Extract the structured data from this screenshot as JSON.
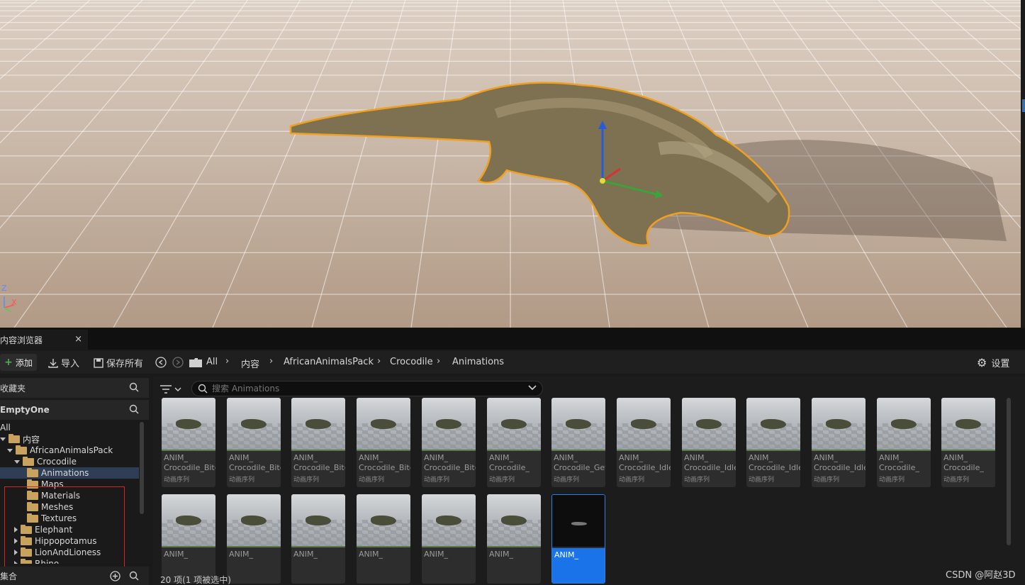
{
  "viewport": {
    "axis": {
      "z": "Z",
      "x": "X"
    }
  },
  "content_browser": {
    "tab_title": "内容浏览器",
    "tab_close": "×",
    "toolbar": {
      "add_label": "添加",
      "import_label": "导入",
      "save_all_label": "保存所有",
      "settings_label": "设置",
      "breadcrumb": [
        "All",
        "内容",
        "AfricanAnimalsPack",
        "Crocodile",
        "Animations"
      ]
    },
    "sidebar": {
      "favorites_label": "收藏夹",
      "project_label": "EmptyOne",
      "collections_label": "集合",
      "tree": [
        {
          "label": "All",
          "depth": 0,
          "expander": "none",
          "folder": false
        },
        {
          "label": "内容",
          "depth": 0,
          "expander": "down",
          "folder": true
        },
        {
          "label": "AfricanAnimalsPack",
          "depth": 1,
          "expander": "down",
          "folder": true
        },
        {
          "label": "Crocodile",
          "depth": 2,
          "expander": "down",
          "folder": true
        },
        {
          "label": "Animations",
          "depth": 3,
          "expander": "none",
          "folder": true,
          "selected": true
        },
        {
          "label": "Maps",
          "depth": 3,
          "expander": "none",
          "folder": true
        },
        {
          "label": "Materials",
          "depth": 3,
          "expander": "none",
          "folder": true
        },
        {
          "label": "Meshes",
          "depth": 3,
          "expander": "none",
          "folder": true
        },
        {
          "label": "Textures",
          "depth": 3,
          "expander": "none",
          "folder": true
        },
        {
          "label": "Elephant",
          "depth": 2,
          "expander": "right",
          "folder": true
        },
        {
          "label": "Hippopotamus",
          "depth": 2,
          "expander": "right",
          "folder": true
        },
        {
          "label": "LionAndLioness",
          "depth": 2,
          "expander": "right",
          "folder": true
        },
        {
          "label": "Rhino",
          "depth": 2,
          "expander": "right",
          "folder": true
        }
      ]
    },
    "search": {
      "placeholder": "搜索 Animations"
    },
    "assets": [
      {
        "line1": "ANIM_",
        "line2": "Crocodile_Bite",
        "type": "动画序列"
      },
      {
        "line1": "ANIM_",
        "line2": "Crocodile_Bite",
        "type": "动画序列"
      },
      {
        "line1": "ANIM_",
        "line2": "Crocodile_Bite",
        "type": "动画序列"
      },
      {
        "line1": "ANIM_",
        "line2": "Crocodile_Bite",
        "type": "动画序列"
      },
      {
        "line1": "ANIM_",
        "line2": "Crocodile_Bite",
        "type": "动画序列"
      },
      {
        "line1": "ANIM_",
        "line2": "Crocodile_",
        "type": "动画序列"
      },
      {
        "line1": "ANIM_",
        "line2": "Crocodile_Get",
        "type": "动画序列"
      },
      {
        "line1": "ANIM_",
        "line2": "Crocodile_Idle",
        "type": "动画序列"
      },
      {
        "line1": "ANIM_",
        "line2": "Crocodile_Idle",
        "type": "动画序列"
      },
      {
        "line1": "ANIM_",
        "line2": "Crocodile_Idle",
        "type": "动画序列"
      },
      {
        "line1": "ANIM_",
        "line2": "Crocodile_Idle",
        "type": "动画序列"
      },
      {
        "line1": "ANIM_",
        "line2": "Crocodile_",
        "type": "动画序列"
      },
      {
        "line1": "ANIM_",
        "line2": "Crocodile_",
        "type": "动画序列"
      },
      {
        "line1": "ANIM_",
        "line2": "",
        "type": ""
      },
      {
        "line1": "ANIM_",
        "line2": "",
        "type": ""
      },
      {
        "line1": "ANIM_",
        "line2": "",
        "type": ""
      },
      {
        "line1": "ANIM_",
        "line2": "",
        "type": ""
      },
      {
        "line1": "ANIM_",
        "line2": "",
        "type": ""
      },
      {
        "line1": "ANIM_",
        "line2": "",
        "type": ""
      },
      {
        "line1": "ANIM_",
        "line2": "",
        "type": "",
        "selected": true
      }
    ],
    "status": "20 项(1 项被选中)"
  },
  "watermark": "CSDN @阿赵3D",
  "colors": {
    "selection_outline": "#f0a020",
    "selected_tile": "#1a73e8",
    "red_box": "#e02020",
    "folder": "#c9a35e",
    "add_plus": "#4caf50"
  }
}
